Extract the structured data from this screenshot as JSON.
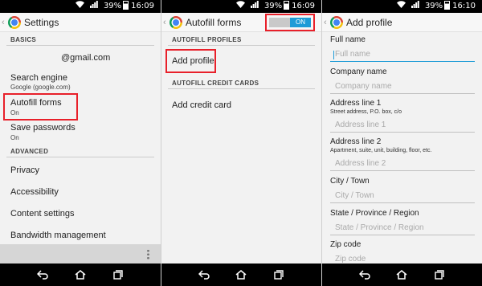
{
  "status": {
    "battery_pct": "39%",
    "time_panel1": "16:09",
    "time_panel2": "16:09",
    "time_panel3": "16:10"
  },
  "panel_settings": {
    "title": "Settings",
    "basics_header": "BASICS",
    "account": "@gmail.com",
    "search_engine_label": "Search engine",
    "search_engine_value": "Google (google.com)",
    "autofill_label": "Autofill forms",
    "autofill_value": "On",
    "save_passwords_label": "Save passwords",
    "save_passwords_value": "On",
    "advanced_header": "ADVANCED",
    "privacy": "Privacy",
    "accessibility": "Accessibility",
    "content_settings": "Content settings",
    "bandwidth": "Bandwidth management"
  },
  "panel_autofill": {
    "title": "Autofill forms",
    "toggle_label": "ON",
    "profiles_header": "AUTOFILL PROFILES",
    "add_profile": "Add profile",
    "cards_header": "AUTOFILL CREDIT CARDS",
    "add_card": "Add credit card"
  },
  "panel_profile": {
    "title": "Add profile",
    "fields": [
      {
        "label": "Full name",
        "hint": "",
        "placeholder": "Full name"
      },
      {
        "label": "Company name",
        "hint": "",
        "placeholder": "Company name"
      },
      {
        "label": "Address line 1",
        "hint": "Street address, P.O. box, c/o",
        "placeholder": "Address line 1"
      },
      {
        "label": "Address line 2",
        "hint": "Apartment, suite, unit, building, floor, etc.",
        "placeholder": "Address line 2"
      },
      {
        "label": "City / Town",
        "hint": "",
        "placeholder": "City / Town"
      },
      {
        "label": "State / Province / Region",
        "hint": "",
        "placeholder": "State / Province / Region"
      },
      {
        "label": "Zip code",
        "hint": "",
        "placeholder": "Zip code"
      }
    ]
  },
  "icons": {
    "back": "back-icon",
    "home": "home-icon",
    "recents": "recents-icon",
    "chrome": "chrome-logo-icon",
    "wifi": "wifi-icon",
    "signal": "signal-icon",
    "battery": "battery-icon",
    "overflow": "overflow-menu-icon"
  },
  "colors": {
    "highlight": "#e8202a",
    "toggle_on": "#1e9bd7",
    "background": "#f2f2f2"
  }
}
